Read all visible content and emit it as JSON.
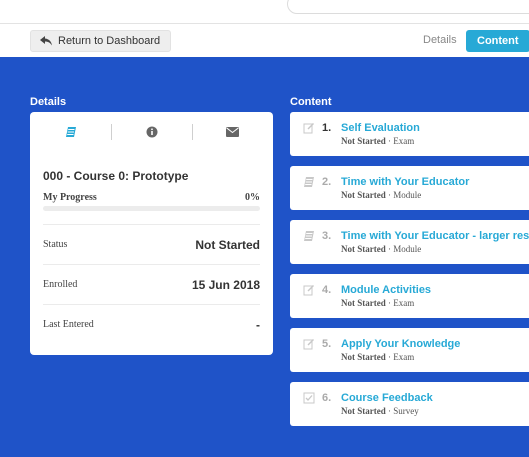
{
  "toolbar": {
    "back_label": "Return to Dashboard",
    "tab_details": "Details",
    "tab_content": "Content"
  },
  "details": {
    "section_title": "Details",
    "icons": [
      "book-icon",
      "info-icon",
      "envelope-icon"
    ],
    "course_title": "000 - Course 0: Prototype",
    "progress_label": "My Progress",
    "progress_value": "0%",
    "progress_fraction": 0,
    "rows": [
      {
        "label": "Status",
        "value": "Not Started"
      },
      {
        "label": "Enrolled",
        "value": "15 Jun 2018"
      },
      {
        "label": "Last Entered",
        "value": "-"
      }
    ]
  },
  "content": {
    "section_title": "Content",
    "items": [
      {
        "num": "1.",
        "title": "Self Evaluation",
        "status": "Not Started",
        "type": " · Exam",
        "icon": "edit-icon"
      },
      {
        "num": "2.",
        "title": "Time with Your Educator",
        "status": "Not Started",
        "type": " · Module",
        "icon": "book-icon"
      },
      {
        "num": "3.",
        "title": "Time with Your Educator - larger resolu",
        "status": "Not Started",
        "type": " · Module",
        "icon": "book-icon"
      },
      {
        "num": "4.",
        "title": "Module Activities",
        "status": "Not Started",
        "type": " · Exam",
        "icon": "edit-icon"
      },
      {
        "num": "5.",
        "title": "Apply Your Knowledge",
        "status": "Not Started",
        "type": " · Exam",
        "icon": "edit-icon"
      },
      {
        "num": "6.",
        "title": "Course Feedback",
        "status": "Not Started",
        "type": " · Survey",
        "icon": "checklist-icon"
      }
    ]
  },
  "colors": {
    "accent": "#27a9d6",
    "background_blue": "#1f53c8"
  }
}
